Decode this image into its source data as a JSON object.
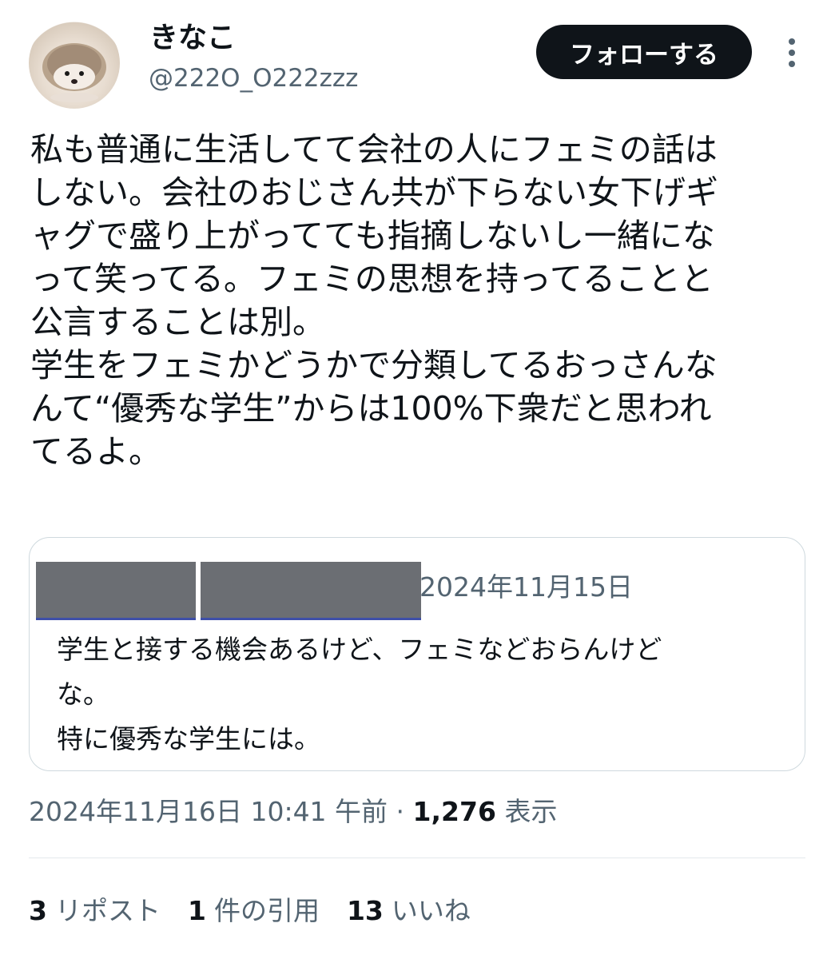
{
  "author": {
    "display_name": "きなこ",
    "handle": "@222O_O222zzz",
    "avatar_icon": "hedgehog-avatar"
  },
  "follow_button_label": "フォローする",
  "more_icon": "more-vertical-icon",
  "tweet_text": "私も普通に生活してて会社の人にフェミの話は\nしない。会社のおじさん共が下らない女下げギ\nャグで盛り上がってても指摘しないし一緒にな\nって笑ってる。フェミの思想を持ってることと\n公言することは別。\n学生をフェミかどうかで分類してるおっさんな\nんて“優秀な学生”からは100%下衆だと思われ\nてるよ。",
  "quote": {
    "date": "2024年11月15日",
    "text": "学生と接する機会あるけど、フェミなどおらんけど\nな。\n特に優秀な学生には。"
  },
  "meta": {
    "timestamp": "2024年11月16日 10:41 午前",
    "separator": "·",
    "views_count": "1,276",
    "views_label": "表示"
  },
  "stats": [
    {
      "count": "3",
      "label": "リポスト"
    },
    {
      "count": "1",
      "label": "件の引用"
    },
    {
      "count": "13",
      "label": "いいね"
    }
  ],
  "colors": {
    "text": "#0f1419",
    "secondary": "#536471",
    "border": "#cfd9de",
    "follow_button_bg": "#0f1419"
  }
}
